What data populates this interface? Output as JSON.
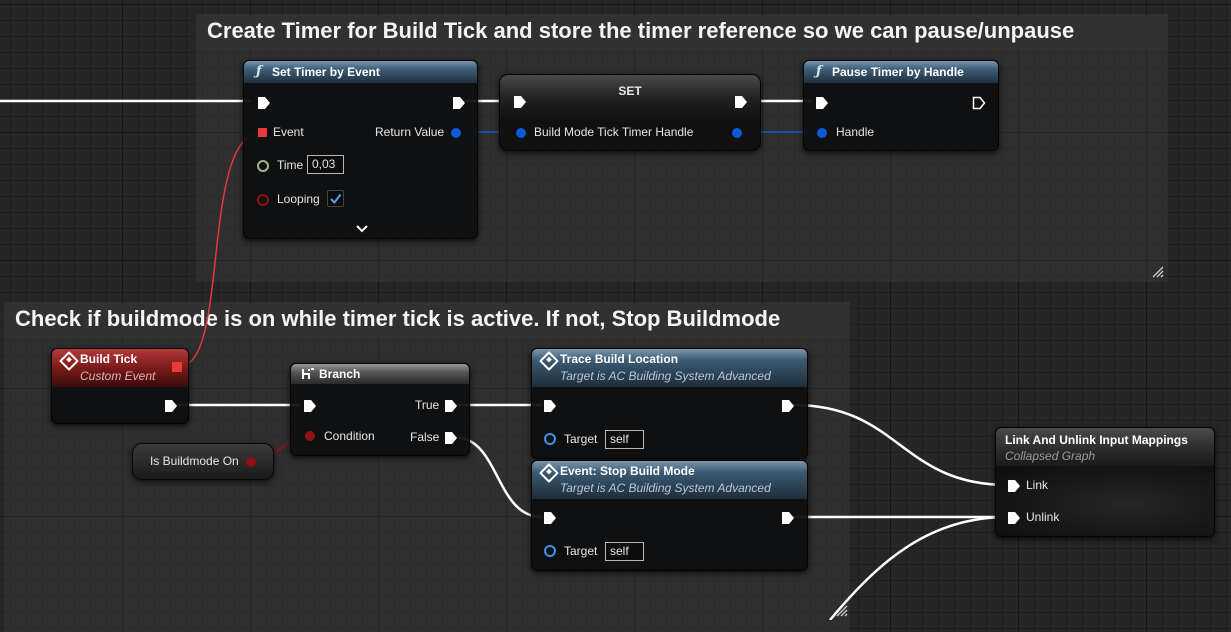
{
  "comments": {
    "timer_title": "Create Timer for Build Tick and store the timer reference so we can pause/unpause",
    "check_title": "Check if buildmode is on while timer tick is active. If not, Stop Buildmode"
  },
  "nodes": {
    "set_timer": {
      "title": "Set Timer by Event",
      "event_label": "Event",
      "return_label": "Return Value",
      "time_label": "Time",
      "time_value": "0,03",
      "looping_label": "Looping",
      "looping_checked": true
    },
    "set_var": {
      "title": "SET",
      "var_label": "Build Mode Tick Timer Handle"
    },
    "pause_timer": {
      "title": "Pause Timer by Handle",
      "handle_label": "Handle"
    },
    "build_tick": {
      "title": "Build Tick",
      "subtitle": "Custom Event"
    },
    "branch": {
      "title": "Branch",
      "true_label": "True",
      "false_label": "False",
      "condition_label": "Condition"
    },
    "is_buildmode": {
      "label": "Is Buildmode On"
    },
    "trace": {
      "title": "Trace Build Location",
      "subtitle": "Target is AC Building System Advanced",
      "target_label": "Target",
      "target_value": "self"
    },
    "stop_build": {
      "title": "Event: Stop Build Mode",
      "subtitle": "Target is AC Building System Advanced",
      "target_label": "Target",
      "target_value": "self"
    },
    "link_unlink": {
      "title": "Link And Unlink Input Mappings",
      "subtitle": "Collapsed Graph",
      "link_label": "Link",
      "unlink_label": "Unlink"
    }
  },
  "colors": {
    "exec": "#ffffff",
    "struct_pin": "#0f58d8",
    "delegate_pin": "#e83a3a",
    "float_pin": "#9cbb8c",
    "bool_pin": "#931010"
  },
  "icons": [
    "function-icon",
    "event-icon",
    "branch-icon",
    "expand-chevron-icon",
    "resize-grip-icon"
  ]
}
